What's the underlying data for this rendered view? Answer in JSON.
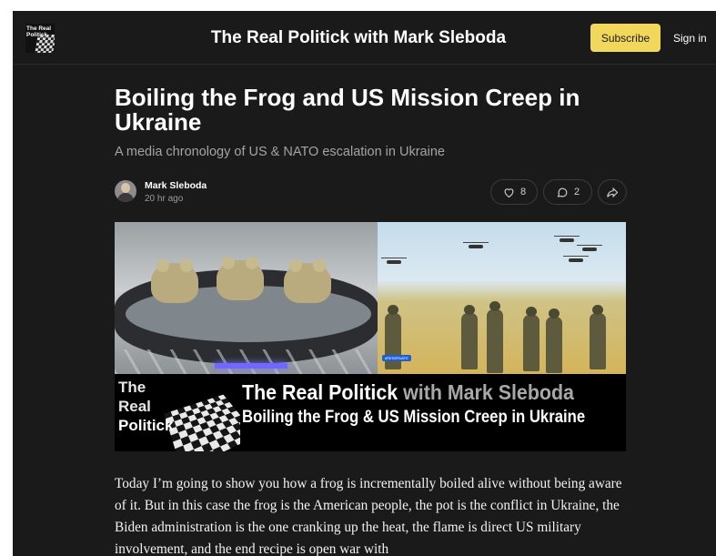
{
  "header": {
    "logo_text": "The Real Politick",
    "site_title": "The Real Politick with Mark Sleboda",
    "subscribe_label": "Subscribe",
    "signin_label": "Sign in"
  },
  "post": {
    "title": "Boiling the Frog and US Mission Creep in Ukraine",
    "subtitle": "A media chronology of US & NATO escalation in Ukraine",
    "author": "Mark Sleboda",
    "time_ago": "20 hr ago",
    "like_count": "8",
    "comment_count": "2",
    "body": "Today I’m going to show you how a frog is incrementally boiled alive without being aware of it. But in this case the frog is the American people, the pot is the conflict in Ukraine, the Biden administration is the one cranking up the heat, the flame is direct US military involvement, and the end recipe is open war with"
  },
  "hero": {
    "banner_logo_lines": [
      "The",
      "Real",
      "Politick"
    ],
    "banner_line1_a": "The Real Politick",
    "banner_line1_b": " with Mark Sleboda",
    "banner_line2": "Boiling the Frog & US Mission Creep in Ukraine",
    "tag": "#RESERVATE"
  },
  "colors": {
    "background": "#1a1a1a",
    "accent": "#f1d75b"
  },
  "icons": [
    "heart-icon",
    "comment-icon",
    "share-icon"
  ]
}
